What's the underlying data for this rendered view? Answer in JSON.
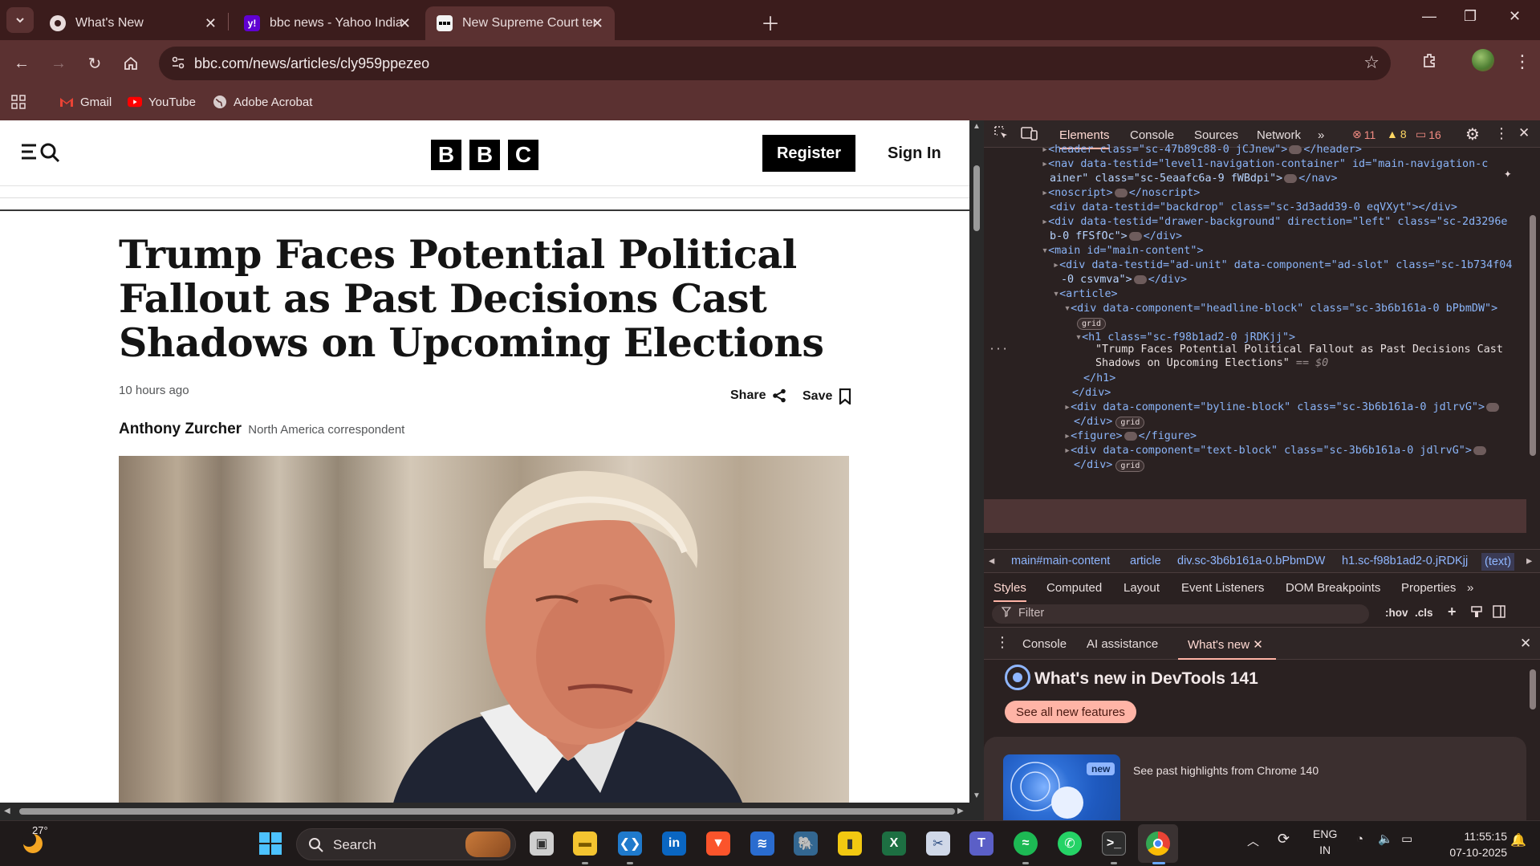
{
  "tabs": [
    {
      "title": "What's New"
    },
    {
      "title": "bbc news - Yahoo India Search Results"
    },
    {
      "title": "New Supreme Court term will roll on"
    }
  ],
  "toolbar": {
    "url": "bbc.com/news/articles/cly959ppezeo"
  },
  "bookmarks": [
    {
      "label": "Gmail"
    },
    {
      "label": "YouTube"
    },
    {
      "label": "Adobe Acrobat"
    }
  ],
  "bbc": {
    "logo": [
      "B",
      "B",
      "C"
    ],
    "register": "Register",
    "signin": "Sign In"
  },
  "article": {
    "headline": "Trump Faces Potential Political Fallout as Past Decisions Cast Shadows on Upcoming Elections",
    "time": "10 hours ago",
    "share": "Share",
    "save": "Save",
    "author": "Anthony Zurcher",
    "role": "North America correspondent"
  },
  "devtools": {
    "tabs": [
      "Elements",
      "Console",
      "Sources",
      "Network"
    ],
    "errors": "11",
    "warnings": "8",
    "issues": "16",
    "crumbs": [
      "main#main-content",
      "article",
      "div.sc-3b6b161a-0.bPbmDW",
      "h1.sc-f98b1ad2-0.jRDKjj",
      "(text)"
    ],
    "style_tabs": [
      "Styles",
      "Computed",
      "Layout",
      "Event Listeners",
      "DOM Breakpoints",
      "Properties"
    ],
    "filter_placeholder": "Filter",
    "hov": ":hov",
    "cls": ".cls",
    "drawer_tabs": [
      "Console",
      "AI assistance",
      "What's new"
    ],
    "whatsnew_title": "What's new in DevTools 141",
    "see_all": "See all new features",
    "card_new": "new",
    "card_text": "See past highlights from Chrome 140",
    "dom": {
      "l0a": "<header class=\"sc-47b89c88-0 jCJnew\">",
      "l0b": "</header>",
      "l1": "<nav data-testid=\"level1-navigation-container\" id=\"main-navigation-c",
      "l1b": "ainer\" class=\"sc-5eaafc6a-9 fWBdpi\">",
      "l1c": "</nav>",
      "l2": "<noscript>",
      "l2b": "</noscript>",
      "l3": "<div data-testid=\"backdrop\" class=\"sc-3d3add39-0 eqVXyt\"></div>",
      "l4": "<div data-testid=\"drawer-background\" direction=\"left\" class=\"sc-2d3296e",
      "l4b": "b-0 fFSfOc\">",
      "l4c": "</div>",
      "l5": "<main id=\"main-content\">",
      "l6": "<div data-testid=\"ad-unit\" data-component=\"ad-slot\" class=\"sc-1b734f04",
      "l6b": "-0 csvmva\">",
      "l6c": "</div>",
      "l7": "<article>",
      "l8": "<div data-component=\"headline-block\" class=\"sc-3b6b161a-0 bPbmDW\">",
      "l9": "grid",
      "l10": "<h1 class=\"sc-f98b1ad2-0 jRDKjj\">",
      "l11": "\"Trump Faces Potential Political Fallout as Past Decisions Cast",
      "l11b": "Shadows on Upcoming Elections\"",
      "l11c": "== $0",
      "l12": "</h1>",
      "l13": "</div>",
      "l14": "<div data-component=\"byline-block\" class=\"sc-3b6b161a-0 jdlrvG\">",
      "l15": "</div>",
      "l15g": "grid",
      "l16": "<figure>",
      "l16b": "</figure>",
      "l17": "<div data-component=\"text-block\" class=\"sc-3b6b161a-0 jdlrvG\">",
      "l18": "</div>",
      "l18g": "grid"
    }
  },
  "taskbar": {
    "temperature": "27°",
    "search": "Search",
    "lang1": "ENG",
    "lang2": "IN",
    "time": "11:55:15",
    "date": "07-10-2025"
  }
}
